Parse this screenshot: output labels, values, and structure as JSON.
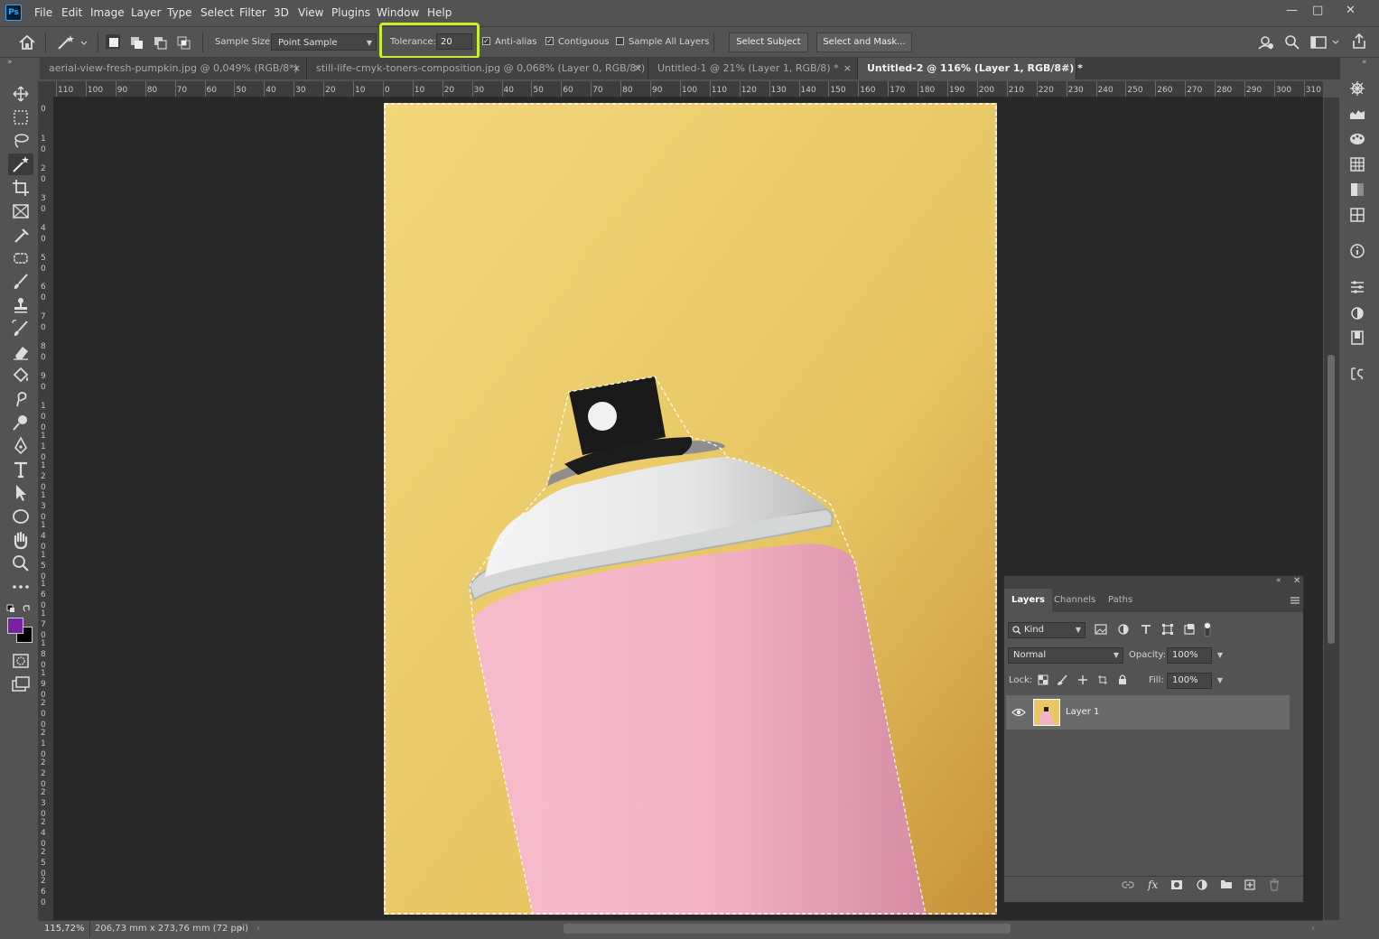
{
  "app": {
    "logo": "Ps"
  },
  "menu": [
    "File",
    "Edit",
    "Image",
    "Layer",
    "Type",
    "Select",
    "Filter",
    "3D",
    "View",
    "Plugins",
    "Window",
    "Help"
  ],
  "window_controls": {
    "minimize": "—",
    "maximize": "□",
    "close": "✕"
  },
  "options": {
    "sample_size_label": "Sample Size:",
    "sample_size_value": "Point Sample",
    "tolerance_label": "Tolerance:",
    "tolerance_value": "20",
    "anti_alias_label": "Anti-alias",
    "anti_alias_checked": true,
    "contiguous_label": "Contiguous",
    "contiguous_checked": true,
    "sample_all_layers_label": "Sample All Layers",
    "sample_all_layers_checked": false,
    "select_subject_label": "Select Subject",
    "select_and_mask_label": "Select and Mask...",
    "highlight_color": "#c6f02c"
  },
  "tabs": [
    {
      "label": "aerial-view-fresh-pumpkin.jpg @ 0,049% (RGB/8*)",
      "active": false
    },
    {
      "label": "still-life-cmyk-toners-composition.jpg @ 0,068% (Layer 0, RGB/8*) *",
      "active": false
    },
    {
      "label": "Untitled-1 @ 21% (Layer 1, RGB/8) *",
      "active": false
    },
    {
      "label": "Untitled-2 @ 116% (Layer 1, RGB/8#) *",
      "active": true
    }
  ],
  "tab_close": "×",
  "ruler_top": [
    "110",
    "100",
    "90",
    "80",
    "70",
    "60",
    "50",
    "40",
    "30",
    "20",
    "10",
    "0",
    "10",
    "20",
    "30",
    "40",
    "50",
    "60",
    "70",
    "80",
    "90",
    "100",
    "110",
    "120",
    "130",
    "140",
    "150",
    "160",
    "170",
    "180",
    "190",
    "200",
    "210",
    "220",
    "230",
    "240",
    "250",
    "260",
    "270",
    "280",
    "290",
    "300",
    "310"
  ],
  "ruler_left": [
    "0",
    "1 0",
    "2 0",
    "3 0",
    "4 0",
    "5 0",
    "6 0",
    "7 0",
    "8 0",
    "9 0",
    "1 0 0",
    "1 1 0",
    "1 2 0",
    "1 3 0",
    "1 4 0",
    "1 5 0",
    "1 6 0",
    "1 7 0",
    "1 8 0",
    "1 9 0",
    "2 0 0",
    "2 1 0",
    "2 2 0",
    "2 3 0",
    "2 4 0",
    "2 5 0",
    "2 6 0"
  ],
  "colors": {
    "foreground": "#7a1fa8",
    "background": "#000000",
    "canvas_bg": "#282828",
    "doc_yellow": "#eccd6a",
    "can_pink": "#f2b3c4"
  },
  "layers_panel": {
    "tabs": [
      "Layers",
      "Channels",
      "Paths"
    ],
    "kind_label": "Kind",
    "blend_mode": "Normal",
    "opacity_label": "Opacity:",
    "opacity_value": "100%",
    "lock_label": "Lock:",
    "fill_label": "Fill:",
    "fill_value": "100%",
    "layers": [
      {
        "name": "Layer 1",
        "visible": true
      }
    ]
  },
  "status": {
    "zoom": "115,72%",
    "doc_size": "206,73 mm x 273,76 mm (72 ppi)"
  }
}
